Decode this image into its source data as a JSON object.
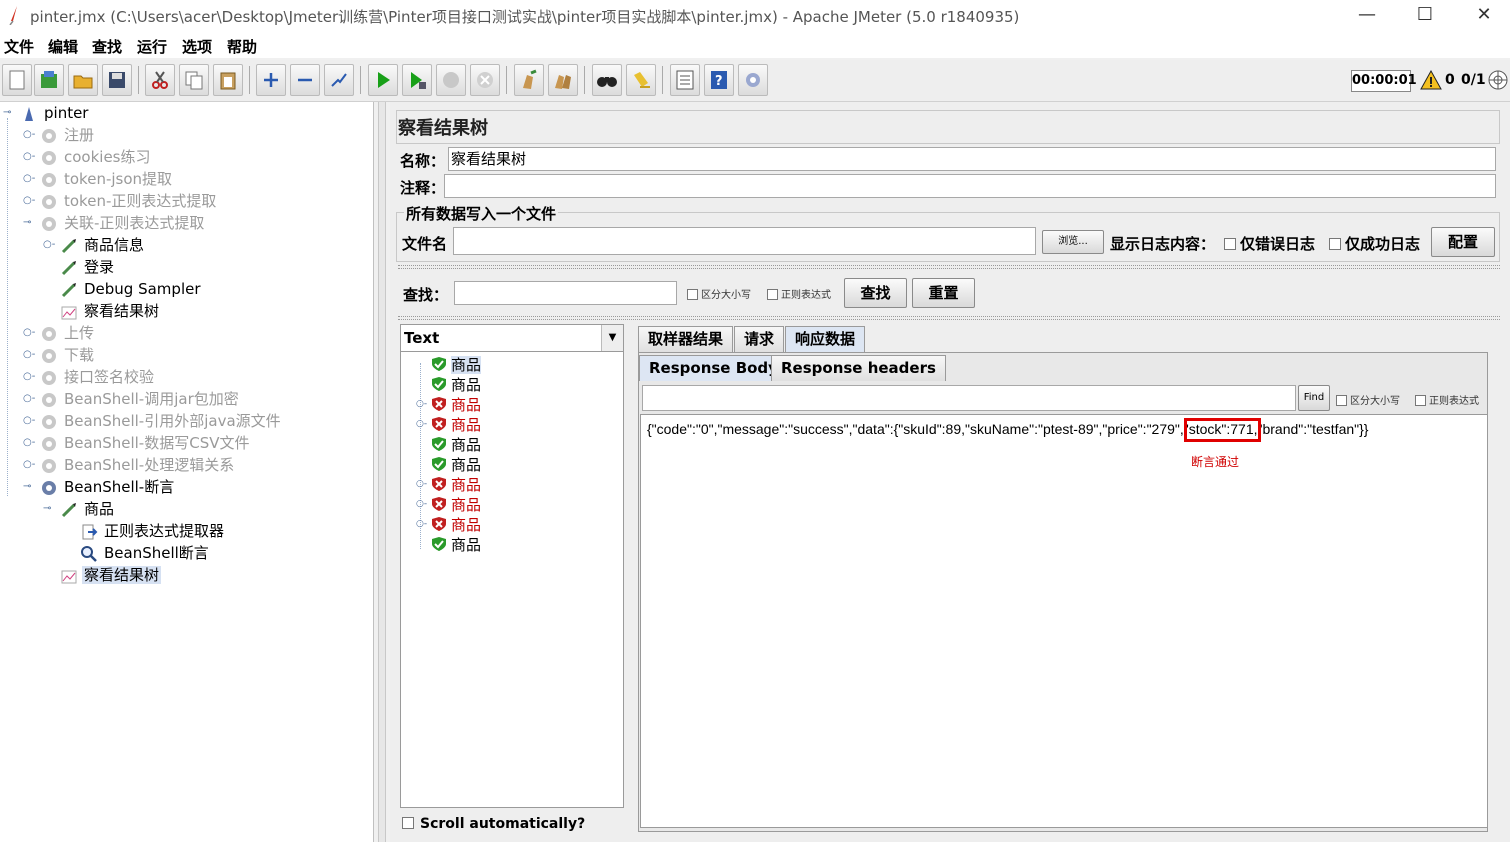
{
  "window": {
    "title": "pinter.jmx (C:\\Users\\acer\\Desktop\\Jmeter训练营\\Pinter项目接口测试实战\\pinter项目实战脚本\\pinter.jmx) - Apache JMeter (5.0 r1840935)",
    "minimize": "—",
    "maximize": "☐",
    "close": "✕"
  },
  "menu": [
    "文件",
    "编辑",
    "查找",
    "运行",
    "选项",
    "帮助"
  ],
  "toolbar": {
    "timer": "00:00:01",
    "warnings": "0",
    "threads": "0/1"
  },
  "tree": {
    "root": "pinter",
    "items": [
      {
        "label": "注册"
      },
      {
        "label": "cookies练习"
      },
      {
        "label": "token-json提取"
      },
      {
        "label": "token-正则表达式提取"
      },
      {
        "label": "关联-正则表达式提取"
      },
      {
        "label": "商品信息"
      },
      {
        "label": "登录"
      },
      {
        "label": "Debug Sampler"
      },
      {
        "label": "察看结果树"
      },
      {
        "label": "上传"
      },
      {
        "label": "下载"
      },
      {
        "label": "接口签名校验"
      },
      {
        "label": "BeanShell-调用jar包加密"
      },
      {
        "label": "BeanShell-引用外部java源文件"
      },
      {
        "label": "BeanShell-数据写CSV文件"
      },
      {
        "label": "BeanShell-处理逻辑关系"
      },
      {
        "label": "BeanShell-断言"
      },
      {
        "label": "商品"
      },
      {
        "label": "正则表达式提取器"
      },
      {
        "label": "BeanShell断言"
      },
      {
        "label": "察看结果树"
      }
    ]
  },
  "panel": {
    "title": "察看结果树",
    "name_label": "名称：",
    "name_value": "察看结果树",
    "comment_label": "注释：",
    "file_section": "所有数据写入一个文件",
    "filename_label": "文件名",
    "browse_btn": "浏览...",
    "log_label": "显示日志内容：",
    "errors_only": "仅错误日志",
    "success_only": "仅成功日志",
    "config_btn": "配置",
    "search_label": "查找：",
    "case_sensitive": "区分大小写",
    "regex": "正则表达式",
    "find_btn": "查找",
    "reset_btn": "重置"
  },
  "results": {
    "renderer": "Text",
    "items": [
      {
        "label": "商品",
        "status": "pass"
      },
      {
        "label": "商品",
        "status": "pass"
      },
      {
        "label": "商品",
        "status": "fail"
      },
      {
        "label": "商品",
        "status": "fail"
      },
      {
        "label": "商品",
        "status": "pass"
      },
      {
        "label": "商品",
        "status": "pass"
      },
      {
        "label": "商品",
        "status": "fail"
      },
      {
        "label": "商品",
        "status": "fail"
      },
      {
        "label": "商品",
        "status": "fail"
      },
      {
        "label": "商品",
        "status": "pass"
      }
    ],
    "scroll_auto": "Scroll automatically?"
  },
  "tabs": [
    "取样器结果",
    "请求",
    "响应数据"
  ],
  "subtabs": [
    "Response Body",
    "Response headers"
  ],
  "response": {
    "find_btn": "Find",
    "case_sensitive": "区分大小写",
    "regex": "正则表达式",
    "body": "{\"code\":\"0\",\"message\":\"success\",\"data\":{\"skuId\":89,\"skuName\":\"ptest-89\",\"price\":\"279\",\"stock\":771,\"brand\":\"testfan\"}}",
    "annotation": "断言通过"
  },
  "colors": {
    "fail": "#c00000",
    "highlight": "#e00000",
    "selection": "#d6e1f2"
  }
}
